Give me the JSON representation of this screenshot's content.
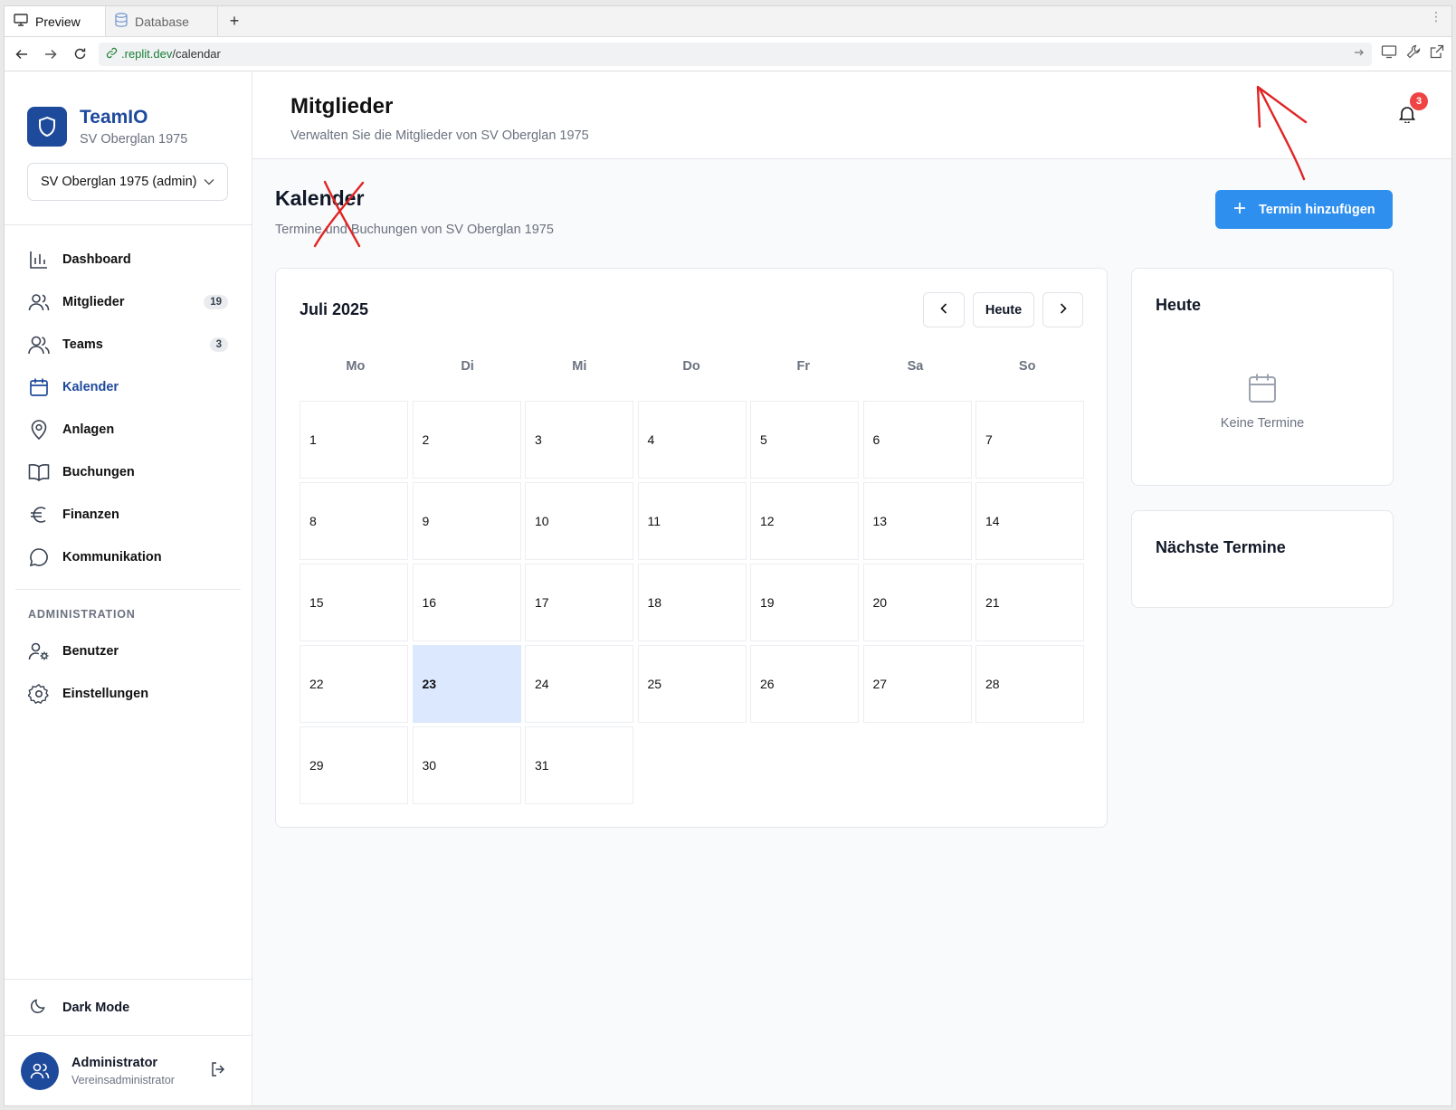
{
  "browser": {
    "tabs": [
      {
        "label": "Preview",
        "icon": "monitor-icon"
      },
      {
        "label": "Database",
        "icon": "database-icon"
      }
    ],
    "new_tab": "+",
    "url_domain": ".replit.dev",
    "url_path": "/calendar"
  },
  "sidebar": {
    "brand_name": "TeamIO",
    "brand_sub": "SV Oberglan 1975",
    "club_select": "SV Oberglan 1975 (admin)",
    "items": [
      {
        "label": "Dashboard",
        "icon": "bar-chart-icon"
      },
      {
        "label": "Mitglieder",
        "icon": "users-icon",
        "badge": "19"
      },
      {
        "label": "Teams",
        "icon": "team-icon",
        "badge": "3"
      },
      {
        "label": "Kalender",
        "icon": "calendar-icon",
        "active": true
      },
      {
        "label": "Anlagen",
        "icon": "map-pin-icon"
      },
      {
        "label": "Buchungen",
        "icon": "book-icon"
      },
      {
        "label": "Finanzen",
        "icon": "euro-icon"
      },
      {
        "label": "Kommunikation",
        "icon": "message-icon"
      }
    ],
    "admin_label": "ADMINISTRATION",
    "admin_items": [
      {
        "label": "Benutzer",
        "icon": "user-cog-icon"
      },
      {
        "label": "Einstellungen",
        "icon": "settings-icon"
      }
    ],
    "dark_mode": "Dark Mode",
    "user_name": "Administrator",
    "user_role": "Vereinsadministrator"
  },
  "header": {
    "title": "Mitglieder",
    "subtitle": "Verwalten Sie die Mitglieder von SV Oberglan 1975",
    "notification_count": "3"
  },
  "page": {
    "title": "Kalender",
    "subtitle": "Termine und Buchungen von SV Oberglan 1975",
    "add_button": "Termin hinzufügen"
  },
  "calendar": {
    "month": "Juli 2025",
    "today_button": "Heute",
    "weekdays": [
      "Mo",
      "Di",
      "Mi",
      "Do",
      "Fr",
      "Sa",
      "So"
    ],
    "days": [
      "1",
      "2",
      "3",
      "4",
      "5",
      "6",
      "7",
      "8",
      "9",
      "10",
      "11",
      "12",
      "13",
      "14",
      "15",
      "16",
      "17",
      "18",
      "19",
      "20",
      "21",
      "22",
      "23",
      "24",
      "25",
      "26",
      "27",
      "28",
      "29",
      "30",
      "31"
    ],
    "today": "23"
  },
  "today_panel": {
    "title": "Heute",
    "empty_text": "Keine Termine"
  },
  "upcoming_panel": {
    "title": "Nächste Termine"
  },
  "colors": {
    "brand": "#1e4a9c",
    "accent_button": "#2e8fee",
    "today_highlight": "#dbe8fd",
    "annotation_red": "#e02424"
  }
}
